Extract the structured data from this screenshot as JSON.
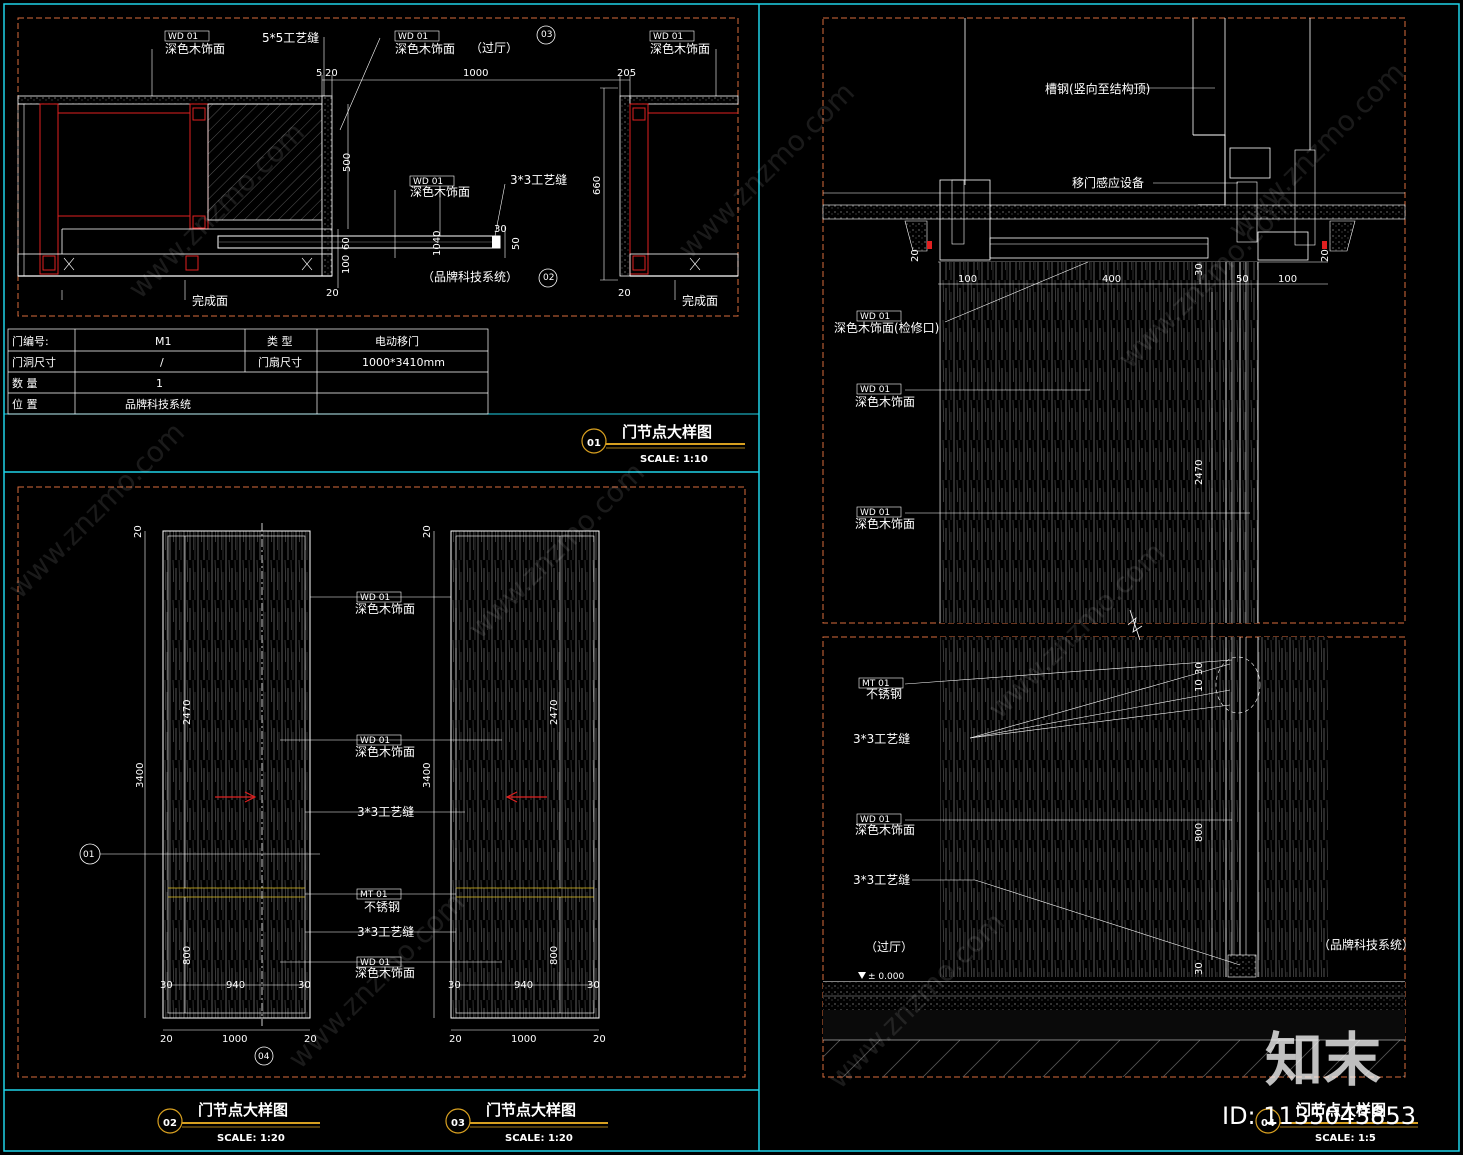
{
  "colors": {
    "frame": "#1fd2e8",
    "border": "#d86c3c",
    "line": "#ffffff",
    "red": "#e02020",
    "dim": "#ffffff",
    "yellow": "#e0c020"
  },
  "plan": {
    "labels": {
      "wood_left": "深色木饰面",
      "tag_wd": "WD 01",
      "craft_seam_55": "5*5工艺缝",
      "wood_mid": "深色木饰面",
      "hall": "（过厅）",
      "wood_right": "深色木饰面",
      "wood_center": "深色木饰面",
      "craft_seam_33": "3*3工艺缝",
      "brand_system": "（品牌科技系统）",
      "finish_left": "完成面",
      "finish_right": "完成面"
    },
    "dims": {
      "d5": "5",
      "d20a": "20",
      "d1000": "1000",
      "d205": "205",
      "d500": "500",
      "d660": "660",
      "d100": "100",
      "d60": "60",
      "d1040": "1040",
      "d30": "30",
      "d50": "50",
      "d20b": "20",
      "d20c": "20"
    },
    "section_marks": {
      "top": "03",
      "bottom": "02"
    }
  },
  "table": {
    "rows": [
      {
        "k1": "门编号:",
        "v1": "M1",
        "k2": "类 型",
        "v2": "电动移门"
      },
      {
        "k1": "门洞尺寸",
        "v1": "/",
        "k2": "门扇尺寸",
        "v2": "1000*3410mm"
      },
      {
        "k1": "数 量",
        "v1": "1",
        "k2": "",
        "v2": ""
      },
      {
        "k1": "位 置",
        "v1": "品牌科技系统",
        "k2": "",
        "v2": ""
      }
    ]
  },
  "titles": {
    "t01": {
      "num": "01",
      "name": "门节点大样图",
      "scale": "SCALE: 1:10"
    },
    "t02": {
      "num": "02",
      "name": "门节点大样图",
      "scale": "SCALE: 1:20"
    },
    "t03": {
      "num": "03",
      "name": "门节点大样图",
      "scale": "SCALE: 1:20"
    },
    "t04": {
      "num": "04",
      "name": "门节点大样图",
      "scale": "SCALE: 1:5"
    }
  },
  "elev": {
    "labels": {
      "wood1": "深色木饰面",
      "wood2": "深色木饰面",
      "craft": "3*3工艺缝",
      "steel": "不锈钢",
      "craft2": "3*3工艺缝",
      "wood3": "深色木饰面",
      "tag_wd": "WD 01",
      "tag_mt": "MT 01",
      "sec01": "01",
      "sec04": "04"
    },
    "dims": {
      "h3400": "3400",
      "h2470": "2470",
      "h800": "800",
      "w940": "940",
      "w1000": "1000",
      "d20": "20",
      "d30": "30"
    }
  },
  "section": {
    "labels": {
      "channel": "槽钢(竖向至结构顶)",
      "sensor": "移门感应设备",
      "wood_access": "深色木饰面(检修口)",
      "wood1": "深色木饰面",
      "wood2": "深色木饰面",
      "steel": "不锈钢",
      "craft1": "3*3工艺缝",
      "wood3": "深色木饰面",
      "craft2": "3*3工艺缝",
      "hall": "（过厅）",
      "brand": "（品牌科技系统）",
      "level": "± 0.000",
      "tag_wd": "WD 01",
      "tag_mt": "MT 01"
    },
    "dims": {
      "d100a": "100",
      "d400": "400",
      "d30": "30",
      "d50": "50",
      "d100b": "100",
      "d20": "20",
      "d2470": "2470",
      "d800": "800",
      "d10": "10",
      "d30b": "30"
    }
  },
  "watermark": {
    "brand": "知末",
    "site": "www.znzmo.com",
    "id": "ID: 1135043853"
  }
}
